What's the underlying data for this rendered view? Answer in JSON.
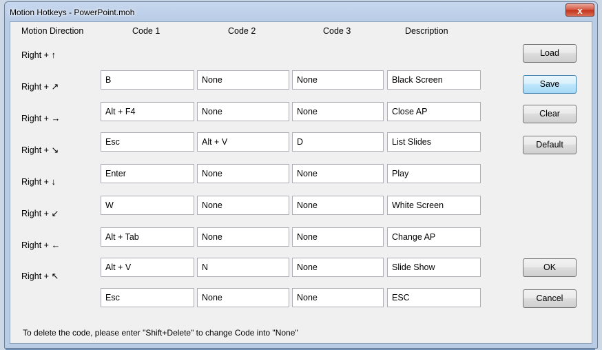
{
  "window": {
    "title": "Motion Hotkeys - PowerPoint.moh",
    "close_glyph": "x"
  },
  "columns": [
    "Motion Direction",
    "Code 1",
    "Code 2",
    "Code 3",
    "Description"
  ],
  "rows": [
    {
      "direction": "Right + ",
      "arrow": "↑",
      "code1": "B",
      "code2": "None",
      "code3": "None",
      "description": "Black Screen"
    },
    {
      "direction": "Right + ",
      "arrow": "↗",
      "code1": "Alt + F4",
      "code2": "None",
      "code3": "None",
      "description": "Close AP"
    },
    {
      "direction": "Right + ",
      "arrow": "→",
      "code1": "Esc",
      "code2": "Alt + V",
      "code3": "D",
      "description": "List Slides"
    },
    {
      "direction": "Right + ",
      "arrow": "↘",
      "code1": "Enter",
      "code2": "None",
      "code3": "None",
      "description": "Play"
    },
    {
      "direction": "Right + ",
      "arrow": "↓",
      "code1": "W",
      "code2": "None",
      "code3": "None",
      "description": "White Screen"
    },
    {
      "direction": "Right + ",
      "arrow": "↙",
      "code1": "Alt + Tab",
      "code2": "None",
      "code3": "None",
      "description": "Change AP"
    },
    {
      "direction": "Right + ",
      "arrow": "←",
      "code1": "Alt + V",
      "code2": "N",
      "code3": "None",
      "description": "Slide Show"
    },
    {
      "direction": "Right + ",
      "arrow": "↖",
      "code1": "Esc",
      "code2": "None",
      "code3": "None",
      "description": "ESC"
    }
  ],
  "buttons": {
    "load": "Load",
    "save": "Save",
    "clear": "Clear",
    "default": "Default",
    "ok": "OK",
    "cancel": "Cancel"
  },
  "note": "To delete the code, please enter \"Shift+Delete\" to change Code into \"None\""
}
